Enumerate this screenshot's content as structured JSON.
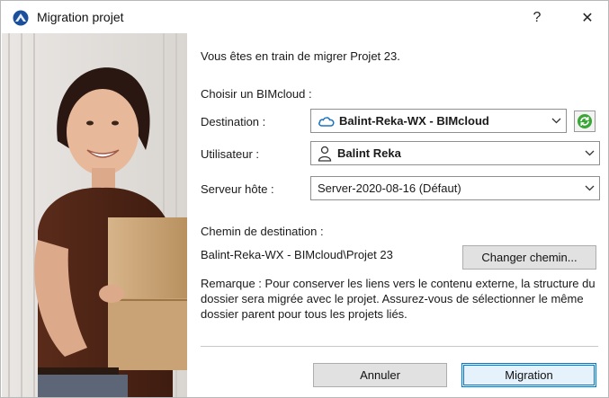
{
  "window": {
    "title": "Migration projet",
    "help_glyph": "?",
    "close_glyph": "✕"
  },
  "intro": "Vous êtes en train de migrer Projet 23.",
  "bimcloud_heading": "Choisir un BIMcloud :",
  "destination": {
    "label": "Destination :",
    "value": "Balint-Reka-WX - BIMcloud",
    "icon": "cloud-icon"
  },
  "user": {
    "label": "Utilisateur :",
    "value": "Balint Reka",
    "icon": "user-icon"
  },
  "host": {
    "label": "Serveur hôte :",
    "value": "Server-2020-08-16 (Défaut)"
  },
  "path": {
    "heading": "Chemin de destination :",
    "value": "Balint-Reka-WX - BIMcloud\\Projet 23",
    "change_button": "Changer chemin..."
  },
  "note": "Remarque : Pour conserver les liens vers le contenu externe, la structure du dossier sera migrée avec le projet. Assurez-vous de sélectionner le même dossier parent pour tous les projets liés.",
  "buttons": {
    "cancel": "Annuler",
    "migrate": "Migration"
  },
  "colors": {
    "accent": "#0078d7",
    "refresh_green": "#3aa635"
  }
}
